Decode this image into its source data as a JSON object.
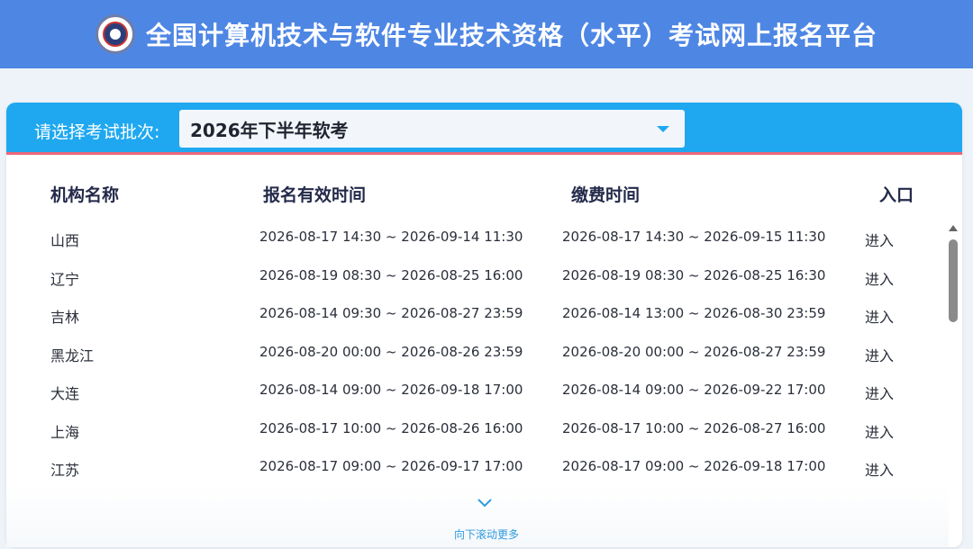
{
  "header": {
    "title": "全国计算机技术与软件专业技术资格（水平）考试网上报名平台",
    "logo": "ruankao-seal-logo"
  },
  "batch": {
    "label": "请选择考试批次:",
    "selected": "2026年下半年软考"
  },
  "table": {
    "columns": [
      "机构名称",
      "报名有效时间",
      "缴费时间",
      "入口"
    ],
    "rows": [
      {
        "org": "山西",
        "reg": "2026-08-17 14:30 ~ 2026-09-14 11:30",
        "pay": "2026-08-17 14:30 ~ 2026-09-15 11:30",
        "entry": "进入"
      },
      {
        "org": "辽宁",
        "reg": "2026-08-19 08:30 ~ 2026-08-25 16:00",
        "pay": "2026-08-19 08:30 ~ 2026-08-25 16:30",
        "entry": "进入"
      },
      {
        "org": "吉林",
        "reg": "2026-08-14 09:30 ~ 2026-08-27 23:59",
        "pay": "2026-08-14 13:00 ~ 2026-08-30 23:59",
        "entry": "进入"
      },
      {
        "org": "黑龙江",
        "reg": "2026-08-20 00:00 ~ 2026-08-26 23:59",
        "pay": "2026-08-20 00:00 ~ 2026-08-27 23:59",
        "entry": "进入"
      },
      {
        "org": "大连",
        "reg": "2026-08-14 09:00 ~ 2026-09-18 17:00",
        "pay": "2026-08-14 09:00 ~ 2026-09-22 17:00",
        "entry": "进入"
      },
      {
        "org": "上海",
        "reg": "2026-08-17 10:00 ~ 2026-08-26 16:00",
        "pay": "2026-08-17 10:00 ~ 2026-08-27 16:00",
        "entry": "进入"
      },
      {
        "org": "江苏",
        "reg": "2026-08-17 09:00 ~ 2026-09-17 17:00",
        "pay": "2026-08-17 09:00 ~ 2026-09-18 17:00",
        "entry": "进入"
      }
    ]
  },
  "scroll_hint": "向下滚动更多",
  "colors": {
    "header_bg": "#4e86e4",
    "batch_bar_bg": "#1fa8f0",
    "accent_line": "#e9677a",
    "hint_color": "#2f9be0"
  },
  "icons": {
    "select_caret": "caret-down-icon",
    "more": "chevron-down-icon"
  }
}
